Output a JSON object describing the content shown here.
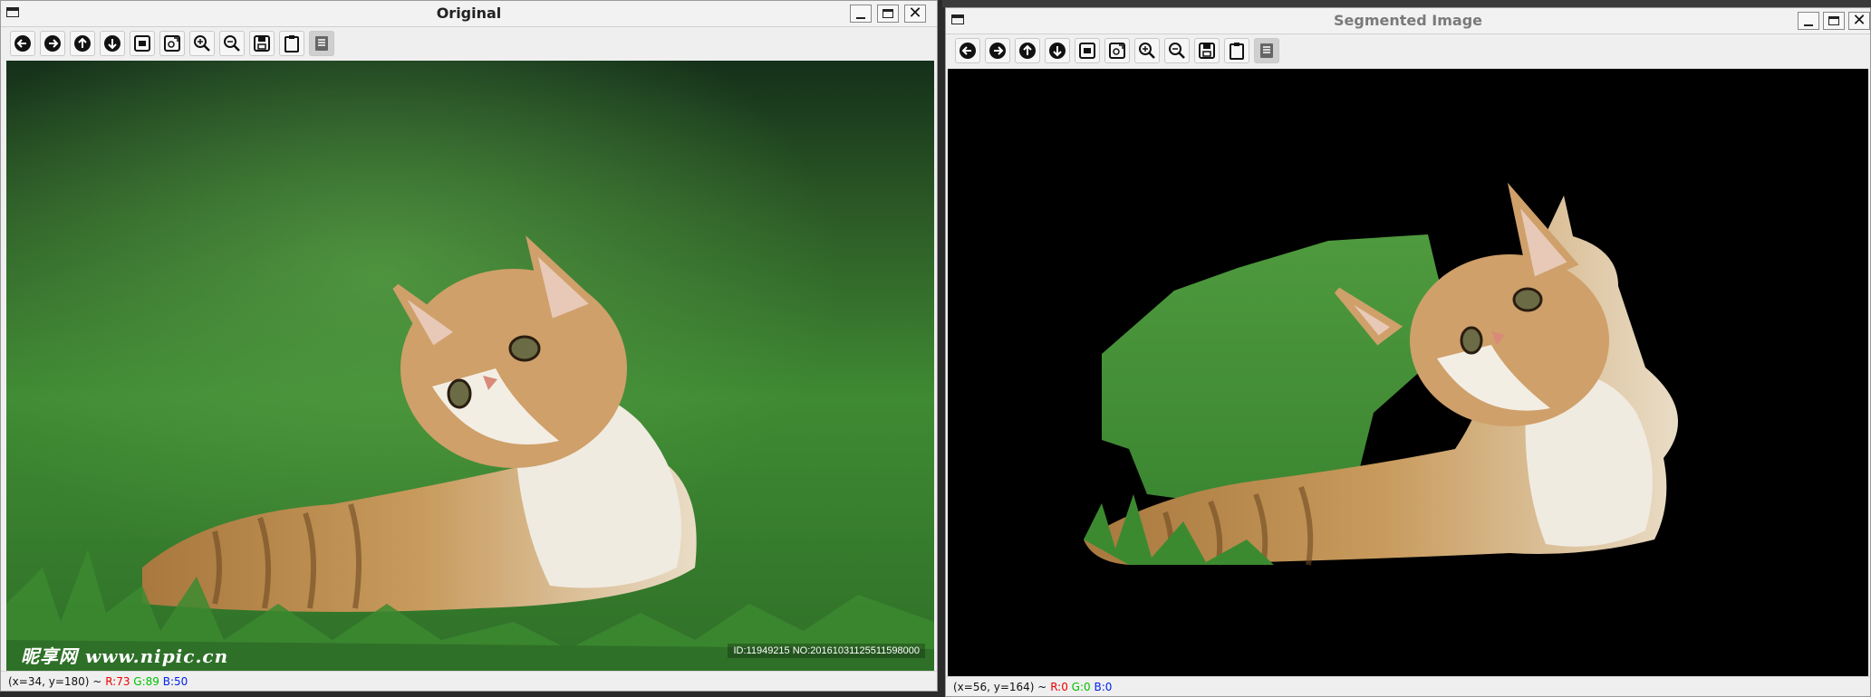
{
  "left_window": {
    "title": "Original",
    "status": {
      "coords": "(x=34, y=180) ~",
      "r": "R:73",
      "g": "G:89",
      "b": "B:50"
    },
    "watermark": {
      "logo": "昵享网 www.nipic.cn",
      "id_text": "ID:11949215 NO:20161031125511598000"
    }
  },
  "right_window": {
    "title": "Segmented Image",
    "status": {
      "coords": "(x=56, y=164) ~",
      "r": "R:0",
      "g": "G:0",
      "b": "B:0"
    }
  },
  "toolbar_icons": [
    "pan-left-icon",
    "pan-right-icon",
    "pan-up-icon",
    "pan-down-icon",
    "zoom-fit-icon",
    "zoom-original-icon",
    "zoom-in-icon",
    "zoom-out-icon",
    "save-icon",
    "copy-to-clipboard-icon",
    "properties-icon"
  ],
  "colors": {
    "grass_dark": "#1f4a1a",
    "grass_mid": "#3f8a33",
    "grass_light": "#5aa548",
    "cat_fur": "#c89a5c",
    "cat_white": "#f0ebe0",
    "segment_bg": "#000000"
  }
}
